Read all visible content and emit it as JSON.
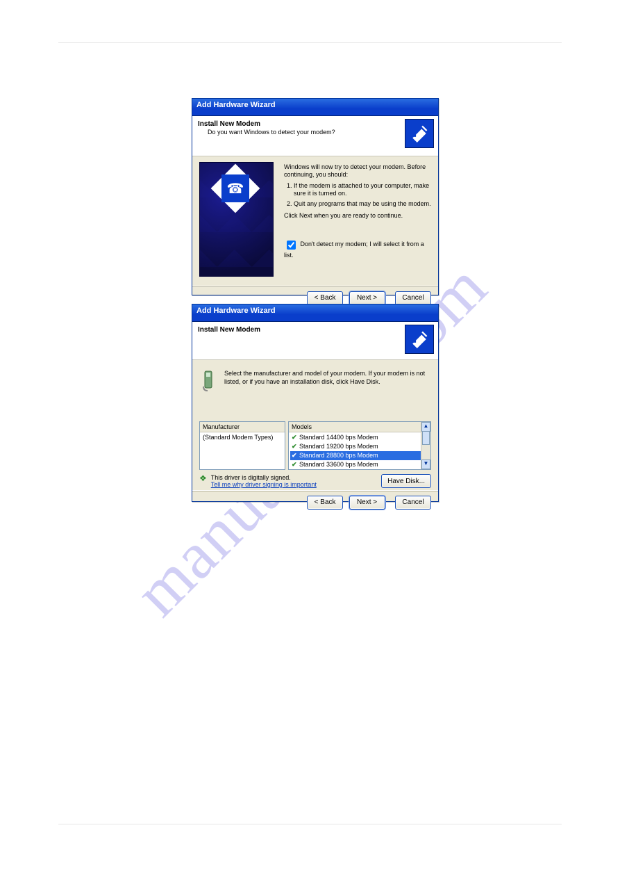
{
  "watermark": "manualslive.com",
  "dialog1": {
    "title": "Add Hardware Wizard",
    "header_title": "Install New Modem",
    "header_sub": "Do you want Windows to detect your modem?",
    "intro": "Windows will now try to detect your modem. Before continuing, you should:",
    "step1": "If the modem is attached to your computer, make sure it is turned on.",
    "step2": "Quit any programs that may be using the modem.",
    "continue": "Click Next when you are ready to continue.",
    "checkbox_label": "Don't detect my modem; I will select it from a list.",
    "checkbox_checked": true,
    "back": "< Back",
    "next": "Next >",
    "cancel": "Cancel"
  },
  "dialog2": {
    "title": "Add Hardware Wizard",
    "header_title": "Install New Modem",
    "instruction": "Select the manufacturer and model of your modem. If your modem is not listed, or if you have an installation disk, click Have Disk.",
    "manu_header": "Manufacturer",
    "manu_items": [
      "(Standard Modem Types)"
    ],
    "models_header": "Models",
    "models_items": [
      "Standard 14400 bps Modem",
      "Standard 19200 bps Modem",
      "Standard 28800 bps Modem",
      "Standard 33600 bps Modem"
    ],
    "models_selected_index": 2,
    "signed_text": "This driver is digitally signed.",
    "signed_link": "Tell me why driver signing is important",
    "have_disk": "Have Disk...",
    "back": "< Back",
    "next": "Next >",
    "cancel": "Cancel"
  }
}
